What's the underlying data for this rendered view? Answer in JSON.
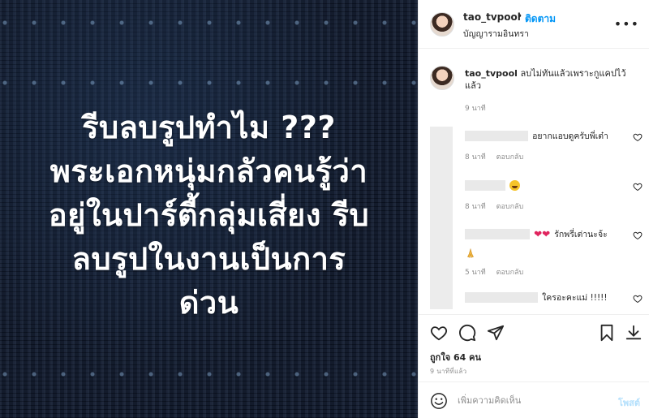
{
  "post_image": {
    "lines": [
      "รีบลบรูปทำไม ???",
      "พระเอกหนุ่มกลัวคนรู้ว่า",
      "อยู่ในปาร์ตี้กลุ่มเสี่ยง รีบ",
      "ลบรูปในงานเป็นการ",
      "ด่วน"
    ]
  },
  "header": {
    "username": "tao_tvpool",
    "separator": "•",
    "follow_label": "ติดตาม",
    "location": "บัญญารามอินทรา",
    "more_icon": "more-horizontal-icon"
  },
  "caption": {
    "username": "tao_tvpool",
    "text": "ลบไม่ทันแล้วเพราะกูแคปไว้แล้ว",
    "time": "9 นาที"
  },
  "comments": [
    {
      "text": "อยากแอบดูครับพี่เต๋า",
      "time": "8 นาที",
      "reply": "ตอบกลับ"
    },
    {
      "text": "",
      "emoji": "grinning-sweat-emoji",
      "time": "8 นาที",
      "reply": "ตอบกลับ"
    },
    {
      "text": "รักพรี่เต่านะจ้ะ",
      "emoji": "red-heart-emoji",
      "time": "5 นาที",
      "reply": "ตอบกลับ"
    },
    {
      "text": "ใครอะคะแม่ !!!!!",
      "time": "",
      "reply": ""
    }
  ],
  "actions": {
    "icons": [
      "heart-icon",
      "comment-icon",
      "share-icon",
      "bookmark-icon",
      "download-icon"
    ],
    "likes": "ถูกใจ 64 คน",
    "post_time": "9 นาทีที่แล้ว"
  },
  "add_comment": {
    "placeholder": "เพิ่มความคิดเห็น",
    "post_label": "โพสต์"
  },
  "colors": {
    "link_blue": "#0095f6",
    "post_disabled": "#b2dffc",
    "muted": "#8e8e8e",
    "image_bg": "#101a2e"
  }
}
